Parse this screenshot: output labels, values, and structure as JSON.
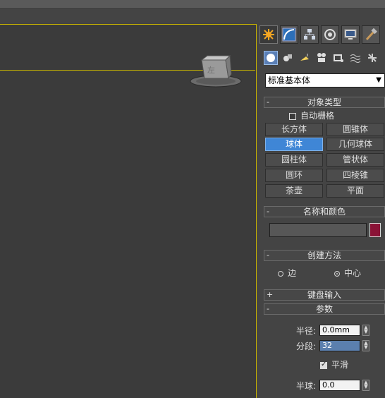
{
  "viewport": {
    "viewcube_label": "左"
  },
  "command_tabs": [
    "create-tab",
    "modify-tab",
    "hierarchy-tab",
    "motion-tab",
    "display-tab",
    "utilities-tab"
  ],
  "sub_icons": [
    "geometry-icon",
    "shapes-icon",
    "lights-icon",
    "cameras-icon",
    "helpers-icon",
    "spacewarps-icon",
    "systems-icon"
  ],
  "category_dropdown": {
    "value": "标准基本体"
  },
  "object_type": {
    "title": "对象类型",
    "sign": "-",
    "autogrid_label": "自动栅格",
    "buttons": [
      "长方体",
      "圆锥体",
      "球体",
      "几何球体",
      "圆柱体",
      "管状体",
      "圆环",
      "四棱锥",
      "茶壶",
      "平面"
    ],
    "active_button": "球体"
  },
  "name_color": {
    "title": "名称和颜色",
    "sign": "-",
    "name_value": "",
    "color": "#8a1236"
  },
  "creation_method": {
    "title": "创建方法",
    "sign": "-",
    "option_edge": "边",
    "option_center": "中心",
    "selected": "中心"
  },
  "keyboard_entry": {
    "title": "键盘输入",
    "sign": "+"
  },
  "parameters": {
    "title": "参数",
    "sign": "-",
    "radius_label": "半径:",
    "radius_value": "0.0mm",
    "segments_label": "分段:",
    "segments_value": "32",
    "smooth_label": "平滑",
    "smooth_checked": true,
    "hemisphere_label": "半球:",
    "hemisphere_value": "0.0"
  }
}
